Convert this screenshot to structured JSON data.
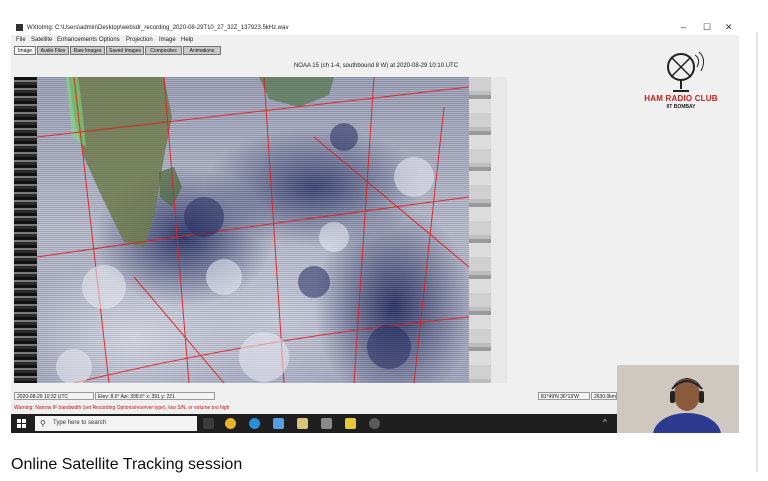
{
  "window": {
    "title": "WXtoImg: C:\\Users\\admin\\Desktop\\websdr_recording_2020-08-29T10_27_32Z_137923.5kHz.wav",
    "controls": {
      "minimize": "–",
      "maximize": "☐",
      "close": "✕"
    }
  },
  "menu": [
    "File",
    "Satellite",
    "Enhancements",
    "Options",
    "Projection",
    "Image",
    "Help"
  ],
  "tabs": [
    "Image",
    "Audio Files",
    "Raw Images",
    "Saved Images",
    "Composites",
    "Animations"
  ],
  "pass_info": "NOAA 15 (ch 1-4, southbound 8 W) at 2020-08-29 10:10 UTC",
  "status_bar": {
    "time": "2020-08-29 10:32 UTC",
    "position": "Elev: 8.0° Azi: 308.6° x: 391 y: 221",
    "coords": "81°49'N 36°13'W",
    "distance": "2630.0km"
  },
  "warning": "Warning: Narrow IF bandwidth (set Recording Options/receiver type), low S/N, or volume too high",
  "logo": {
    "club": "HAM RADIO CLUB",
    "institute": "IIT BOMBAY"
  },
  "taskbar": {
    "search_placeholder": "Type here to search",
    "tray_up": "^"
  },
  "video_title": "Online Satellite Tracking session",
  "colors": {
    "club_red": "#c91e1e",
    "warning_red": "#d01010",
    "taskbar": "#1f1f1f"
  }
}
